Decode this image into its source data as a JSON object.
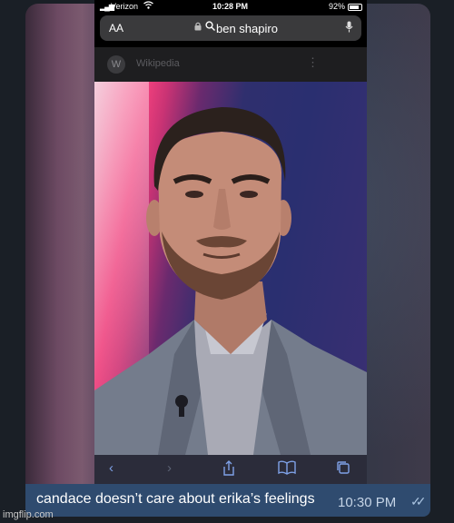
{
  "status_bar": {
    "carrier": "Verizon",
    "time": "10:28 PM",
    "battery": "92%"
  },
  "url_bar": {
    "text_size_label": "AA",
    "query": "ben shapiro"
  },
  "wiki_bar": {
    "title": "Wikipedia"
  },
  "icons": {
    "signal": "cellular-signal-icon",
    "wifi": "wifi-icon",
    "battery": "battery-icon",
    "lock": "lock-icon",
    "search": "search-icon",
    "mic": "microphone-icon",
    "back": "chevron-left-icon",
    "forward": "chevron-right-icon",
    "share": "share-icon",
    "bookmarks": "book-icon",
    "tabs": "tabs-icon",
    "read": "double-check-icon"
  },
  "caption": {
    "text": "candace doesn’t care about erika’s feelings",
    "time": "10:30 PM"
  },
  "watermark": "imgflip.com",
  "colors": {
    "caption_bg": "#2f4b6f",
    "safari_accent": "#7fa2e8"
  }
}
